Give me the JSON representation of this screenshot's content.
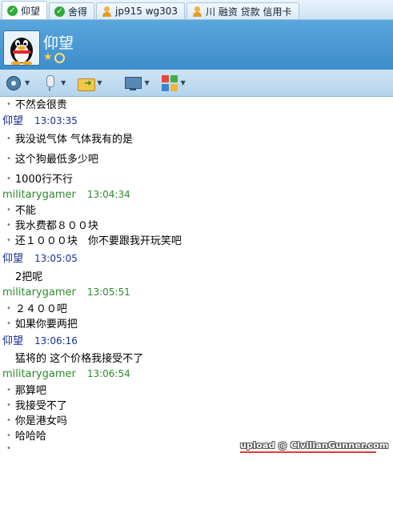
{
  "tabs": [
    {
      "label": "仰望",
      "icon": "check-icon",
      "active": true
    },
    {
      "label": "舍得",
      "icon": "check-icon",
      "active": false
    },
    {
      "label": "jp915 wg303",
      "icon": "user-icon",
      "active": false
    },
    {
      "label": "川 融资 贷款 信用卡",
      "icon": "user-icon",
      "active": false
    }
  ],
  "header": {
    "contact_name": "仰望",
    "avatar": "qq-penguin-avatar",
    "status_icons": [
      "star-icon",
      "ring-icon"
    ]
  },
  "toolbar": {
    "buttons": [
      "video-camera-icon",
      "microphone-icon",
      "file-transfer-icon",
      "add-chat-icon",
      "screen-share-icon",
      "apps-grid-icon"
    ]
  },
  "chat": {
    "messages": [
      {
        "type": "msg",
        "text": "不然会很贵"
      },
      {
        "type": "header",
        "side": "me",
        "sender": "仰望",
        "time": "13:03:35"
      },
      {
        "type": "msg",
        "text": "我没说气体 气体我有的是"
      },
      {
        "type": "msg",
        "text": "这个狗最低多少吧"
      },
      {
        "type": "msg",
        "text": "1000行不行"
      },
      {
        "type": "header",
        "side": "them",
        "sender": "militarygamer",
        "time": "13:04:34"
      },
      {
        "type": "msg",
        "text": "不能"
      },
      {
        "type": "msg",
        "text": "我水费都８００块"
      },
      {
        "type": "msg",
        "text": "还１０００块　你不要跟我开玩笑吧"
      },
      {
        "type": "header",
        "side": "me",
        "sender": "仰望",
        "time": "13:05:05"
      },
      {
        "type": "msg",
        "text": "2把呢",
        "nodot": true
      },
      {
        "type": "header",
        "side": "them",
        "sender": "militarygamer",
        "time": "13:05:51"
      },
      {
        "type": "msg",
        "text": "２４００吧"
      },
      {
        "type": "msg",
        "text": "如果你要两把"
      },
      {
        "type": "header",
        "side": "me",
        "sender": "仰望",
        "time": "13:06:16"
      },
      {
        "type": "msg",
        "text": "猛将的 这个价格我接受不了",
        "nodot": true
      },
      {
        "type": "header",
        "side": "them",
        "sender": "militarygamer",
        "time": "13:06:54"
      },
      {
        "type": "msg",
        "text": "那算吧"
      },
      {
        "type": "msg",
        "text": "我接受不了"
      },
      {
        "type": "msg",
        "text": "你是港女吗"
      },
      {
        "type": "msg",
        "text": "哈哈哈"
      },
      {
        "type": "msg",
        "text": ""
      }
    ]
  },
  "watermark": {
    "text": "upload @ CivilianGunner.com"
  },
  "colors": {
    "header_blue": "#4a9ad6",
    "me_name": "#1a2f9c",
    "them_name": "#2e8a2e"
  }
}
